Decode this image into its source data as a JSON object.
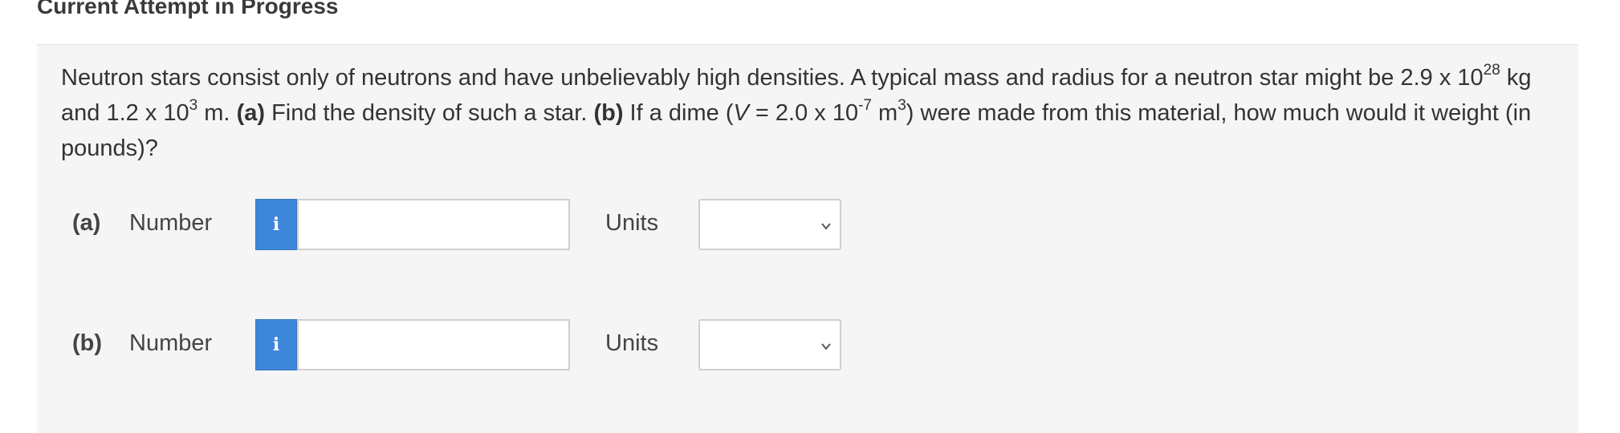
{
  "header": {
    "title": "Current Attempt in Progress"
  },
  "question": {
    "t1": "Neutron stars consist only of neutrons and have unbelievably high densities. A typical mass and radius for a neutron star might be 2.9 x 10",
    "exp1": "28",
    "t2": " kg and 1.2 x 10",
    "exp2": "3",
    "t3": " m. ",
    "part_a_tag": "(a)",
    "t4": " Find the density of such a star. ",
    "part_b_tag": "(b)",
    "t5": " If a dime (",
    "var_v": "V",
    "t6": " = 2.0 x 10",
    "exp3": "-7",
    "t7": " m",
    "exp4": "3",
    "t8": ") were made from this material, how much would it weight (in pounds)?"
  },
  "answers": [
    {
      "part": "(a)",
      "number_label": "Number",
      "info_icon": "i",
      "value": "",
      "units_label": "Units",
      "units_selected": ""
    },
    {
      "part": "(b)",
      "number_label": "Number",
      "info_icon": "i",
      "value": "",
      "units_label": "Units",
      "units_selected": ""
    }
  ],
  "colors": {
    "info_button": "#3d86d9",
    "panel_bg": "#f5f5f5"
  }
}
